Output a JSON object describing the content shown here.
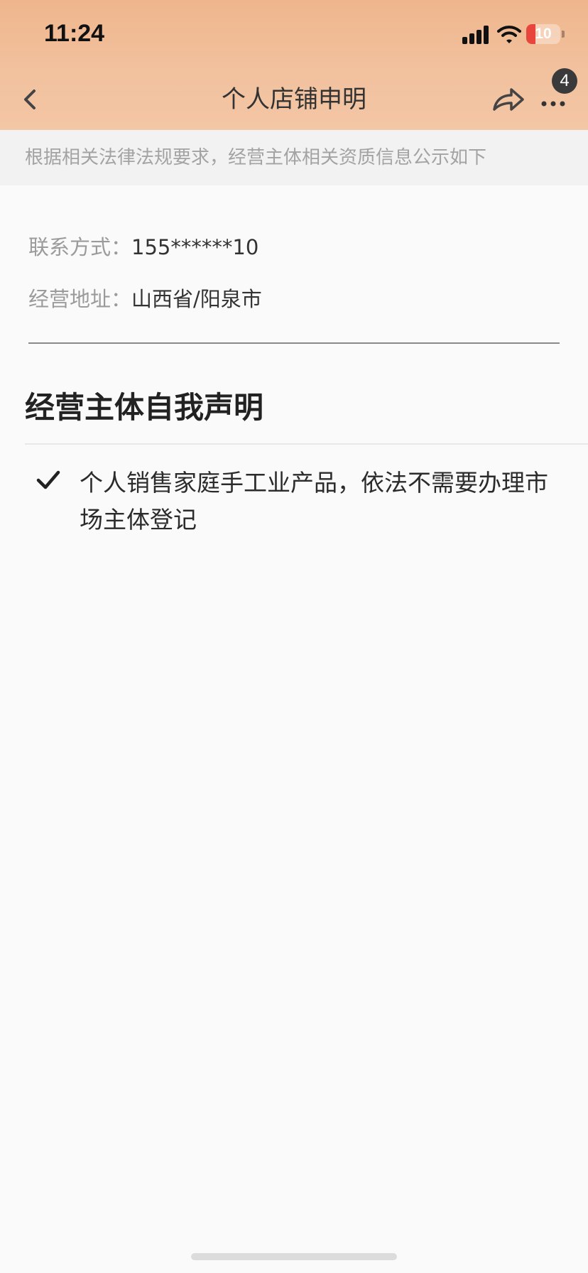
{
  "status_bar": {
    "time": "11:24",
    "battery_level": "10",
    "battery_fraction": 0.1,
    "icons": [
      "signal-icon",
      "wifi-icon",
      "battery-icon"
    ]
  },
  "nav": {
    "title": "个人店铺申明",
    "badge_count": "4",
    "icons": [
      "back-chevron-icon",
      "share-icon",
      "more-dots-icon"
    ]
  },
  "notice": {
    "text": "根据相关法律法规要求，经营主体相关资质信息公示如下"
  },
  "info": {
    "contact_label": "联系方式：",
    "contact_value": "155******10",
    "address_label": "经营地址：",
    "address_value": "山西省/阳泉市"
  },
  "declaration": {
    "title": "经营主体自我声明",
    "items": [
      {
        "icon": "checkmark-icon",
        "text": "个人销售家庭手工业产品，依法不需要办理市场主体登记"
      }
    ]
  },
  "colors": {
    "header_gradient_top": "#efb68d",
    "header_gradient_bottom": "#f3c6a5",
    "page_background": "#fafafa",
    "notice_background": "#f2f2f2",
    "battery_low": "#e8453c"
  }
}
